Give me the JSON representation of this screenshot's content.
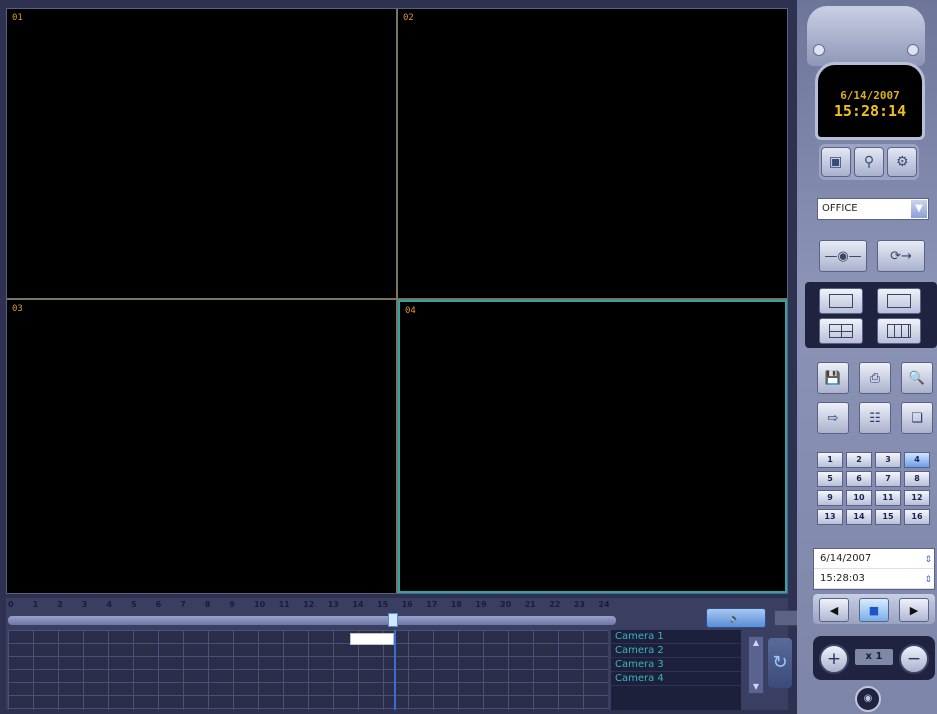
{
  "cameras_view": [
    {
      "label": "01"
    },
    {
      "label": "02"
    },
    {
      "label": "03"
    },
    {
      "label": "04"
    }
  ],
  "timeline": {
    "hours": [
      "0",
      "1",
      "2",
      "3",
      "4",
      "5",
      "6",
      "7",
      "8",
      "9",
      "10",
      "11",
      "12",
      "13",
      "14",
      "15",
      "16",
      "17",
      "18",
      "19",
      "20",
      "21",
      "22",
      "23",
      "24"
    ],
    "audio_label": "",
    "camera_list": [
      "Camera 1",
      "Camera 2",
      "Camera 3",
      "Camera 4"
    ]
  },
  "clock": {
    "date": "6/14/2007",
    "time": "15:28:14"
  },
  "site_select": {
    "value": "OFFICE"
  },
  "channels": [
    "1",
    "2",
    "3",
    "4",
    "5",
    "6",
    "7",
    "8",
    "9",
    "10",
    "11",
    "12",
    "13",
    "14",
    "15",
    "16"
  ],
  "active_channel": "4",
  "search": {
    "date": "6/14/2007",
    "time": "15:28:03"
  },
  "playback": {
    "speed": "x 1"
  },
  "colors": {
    "channel_label": "#d89a2a",
    "active_border": "#2aa5a8",
    "camera_text": "#38b4c0",
    "clock_text": "#f0c020"
  }
}
